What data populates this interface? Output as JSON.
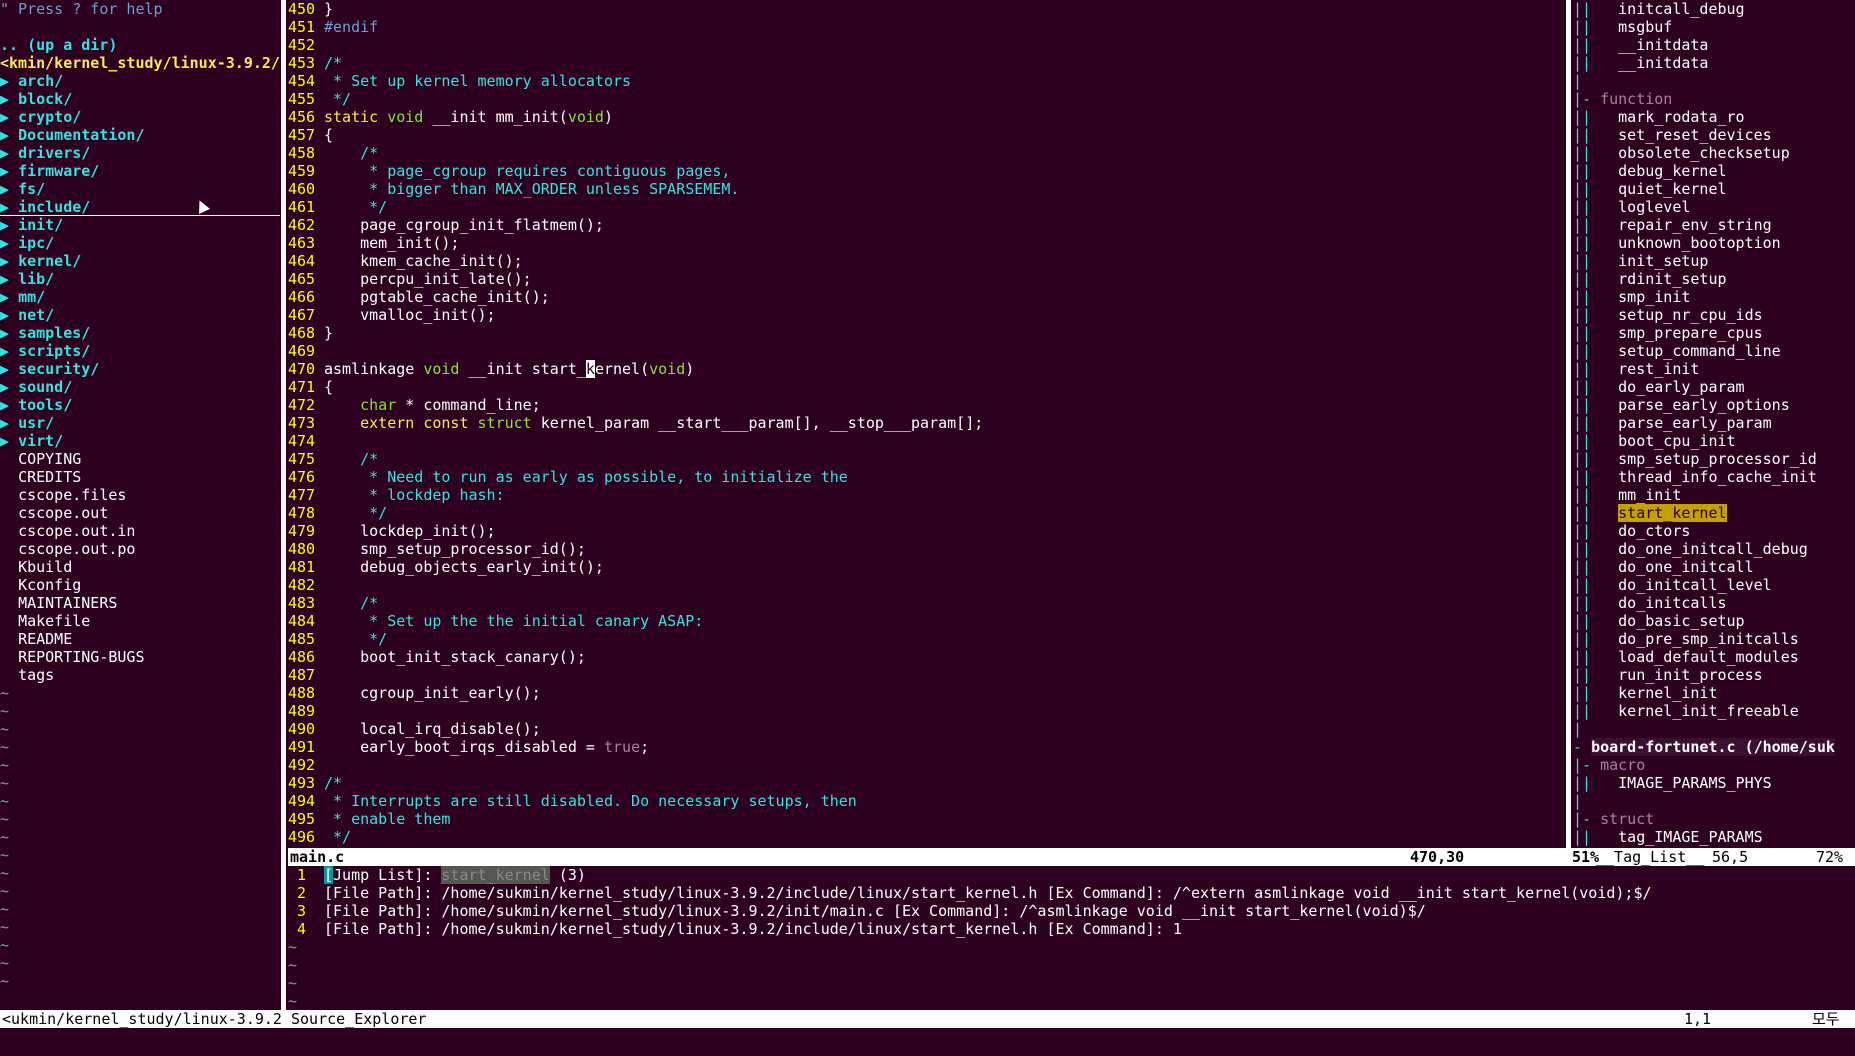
{
  "nerdtree": {
    "help": "\" Press ? for help",
    "up_dir": ".. (up a dir)",
    "cwd": "<kmin/kernel_study/linux-3.9.2/",
    "dirs": [
      "arch/",
      "block/",
      "crypto/",
      "Documentation/",
      "drivers/",
      "firmware/",
      "fs/",
      "include/",
      "init/",
      "ipc/",
      "kernel/",
      "lib/",
      "mm/",
      "net/",
      "samples/",
      "scripts/",
      "security/",
      "sound/",
      "tools/",
      "usr/",
      "virt/"
    ],
    "files": [
      "COPYING",
      "CREDITS",
      "cscope.files",
      "cscope.out",
      "cscope.out.in",
      "cscope.out.po",
      "Kbuild",
      "Kconfig",
      "MAINTAINERS",
      "Makefile",
      "README",
      "REPORTING-BUGS",
      "tags"
    ],
    "dir_arrow": "▶",
    "tilde": "~"
  },
  "code": {
    "lines": [
      {
        "n": "450",
        "t": "}",
        "c": ""
      },
      {
        "n": "451",
        "t": "#endif",
        "c": "pre"
      },
      {
        "n": "452",
        "t": "",
        "c": ""
      },
      {
        "n": "453",
        "t": "/*",
        "c": "cmt"
      },
      {
        "n": "454",
        "t": " * Set up kernel memory allocators",
        "c": "cmt"
      },
      {
        "n": "455",
        "t": " */",
        "c": "cmt"
      },
      {
        "n": "456",
        "t": "static void __init mm_init(void)",
        "c": "sig1"
      },
      {
        "n": "457",
        "t": "{",
        "c": ""
      },
      {
        "n": "458",
        "t": "    /*",
        "c": "cmt"
      },
      {
        "n": "459",
        "t": "     * page_cgroup requires contiguous pages,",
        "c": "cmt"
      },
      {
        "n": "460",
        "t": "     * bigger than MAX_ORDER unless SPARSEMEM.",
        "c": "cmt"
      },
      {
        "n": "461",
        "t": "     */",
        "c": "cmt"
      },
      {
        "n": "462",
        "t": "    page_cgroup_init_flatmem();",
        "c": ""
      },
      {
        "n": "463",
        "t": "    mem_init();",
        "c": ""
      },
      {
        "n": "464",
        "t": "    kmem_cache_init();",
        "c": ""
      },
      {
        "n": "465",
        "t": "    percpu_init_late();",
        "c": ""
      },
      {
        "n": "466",
        "t": "    pgtable_cache_init();",
        "c": ""
      },
      {
        "n": "467",
        "t": "    vmalloc_init();",
        "c": ""
      },
      {
        "n": "468",
        "t": "}",
        "c": ""
      },
      {
        "n": "469",
        "t": "",
        "c": ""
      },
      {
        "n": "470",
        "t": "asmlinkage void __init start_kernel(void)",
        "c": "sig2"
      },
      {
        "n": "471",
        "t": "{",
        "c": ""
      },
      {
        "n": "472",
        "t": "    char * command_line;",
        "c": "decl1"
      },
      {
        "n": "473",
        "t": "    extern const struct kernel_param __start___param[], __stop___param[];",
        "c": "decl2"
      },
      {
        "n": "474",
        "t": "",
        "c": ""
      },
      {
        "n": "475",
        "t": "    /*",
        "c": "cmt"
      },
      {
        "n": "476",
        "t": "     * Need to run as early as possible, to initialize the",
        "c": "cmt"
      },
      {
        "n": "477",
        "t": "     * lockdep hash:",
        "c": "cmt"
      },
      {
        "n": "478",
        "t": "     */",
        "c": "cmt"
      },
      {
        "n": "479",
        "t": "    lockdep_init();",
        "c": ""
      },
      {
        "n": "480",
        "t": "    smp_setup_processor_id();",
        "c": ""
      },
      {
        "n": "481",
        "t": "    debug_objects_early_init();",
        "c": ""
      },
      {
        "n": "482",
        "t": "",
        "c": ""
      },
      {
        "n": "483",
        "t": "    /*",
        "c": "cmt"
      },
      {
        "n": "484",
        "t": "     * Set up the the initial canary ASAP:",
        "c": "cmt"
      },
      {
        "n": "485",
        "t": "     */",
        "c": "cmt"
      },
      {
        "n": "486",
        "t": "    boot_init_stack_canary();",
        "c": ""
      },
      {
        "n": "487",
        "t": "",
        "c": ""
      },
      {
        "n": "488",
        "t": "    cgroup_init_early();",
        "c": ""
      },
      {
        "n": "489",
        "t": "",
        "c": ""
      },
      {
        "n": "490",
        "t": "    local_irq_disable();",
        "c": ""
      },
      {
        "n": "491",
        "t": "    early_boot_irqs_disabled = true;",
        "c": "bool"
      },
      {
        "n": "492",
        "t": "",
        "c": ""
      },
      {
        "n": "493",
        "t": "/*",
        "c": "cmt"
      },
      {
        "n": "494",
        "t": " * Interrupts are still disabled. Do necessary setups, then",
        "c": "cmt"
      },
      {
        "n": "495",
        "t": " * enable them",
        "c": "cmt"
      },
      {
        "n": "496",
        "t": " */",
        "c": "cmt"
      }
    ]
  },
  "taglist": {
    "top_vars": [
      "initcall_debug",
      "msgbuf",
      "__initdata",
      "__initdata"
    ],
    "category_function": "function",
    "functions": [
      "mark_rodata_ro",
      "set_reset_devices",
      "obsolete_checksetup",
      "debug_kernel",
      "quiet_kernel",
      "loglevel",
      "repair_env_string",
      "unknown_bootoption",
      "init_setup",
      "rdinit_setup",
      "smp_init",
      "setup_nr_cpu_ids",
      "smp_prepare_cpus",
      "setup_command_line",
      "rest_init",
      "do_early_param",
      "parse_early_options",
      "parse_early_param",
      "boot_cpu_init",
      "smp_setup_processor_id",
      "thread_info_cache_init",
      "mm_init",
      "start_kernel",
      "do_ctors",
      "do_one_initcall_debug",
      "do_one_initcall",
      "do_initcall_level",
      "do_initcalls",
      "do_basic_setup",
      "do_pre_smp_initcalls",
      "load_default_modules",
      "run_init_process",
      "kernel_init",
      "kernel_init_freeable"
    ],
    "highlighted": "start_kernel",
    "file2": "board-fortunet.c (/home/suk",
    "category_macro": "macro",
    "macros": [
      "IMAGE_PARAMS_PHYS"
    ],
    "category_struct": "struct",
    "structs": [
      "tag_IMAGE_PARAMS"
    ]
  },
  "status_main": {
    "filename": "main.c",
    "position": "470,30",
    "percent": "51%",
    "taglist_label": "__Tag_List__",
    "taglist_pos": "56,5",
    "taglist_percent": "72%"
  },
  "source_explorer": {
    "lines": [
      {
        "n": "1",
        "pre": "[",
        "tag": "Jump List",
        "post": "]: ",
        "hl": "start_kernel",
        "rest": " (3)"
      },
      {
        "n": "2",
        "text": "[File Path]: /home/sukmin/kernel_study/linux-3.9.2/include/linux/start_kernel.h [Ex Command]: /^extern asmlinkage void __init start_kernel(void);$/"
      },
      {
        "n": "3",
        "text": "[File Path]: /home/sukmin/kernel_study/linux-3.9.2/init/main.c [Ex Command]: /^asmlinkage void __init start_kernel(void)$/"
      },
      {
        "n": "4",
        "text": "[File Path]: /home/sukmin/kernel_study/linux-3.9.2/include/linux/start_kernel.h [Ex Command]: 1"
      }
    ]
  },
  "status_bottom": {
    "left": "<ukmin/kernel_study/linux-3.9.2 Source_Explorer",
    "position": "1,1",
    "right": "모두"
  }
}
